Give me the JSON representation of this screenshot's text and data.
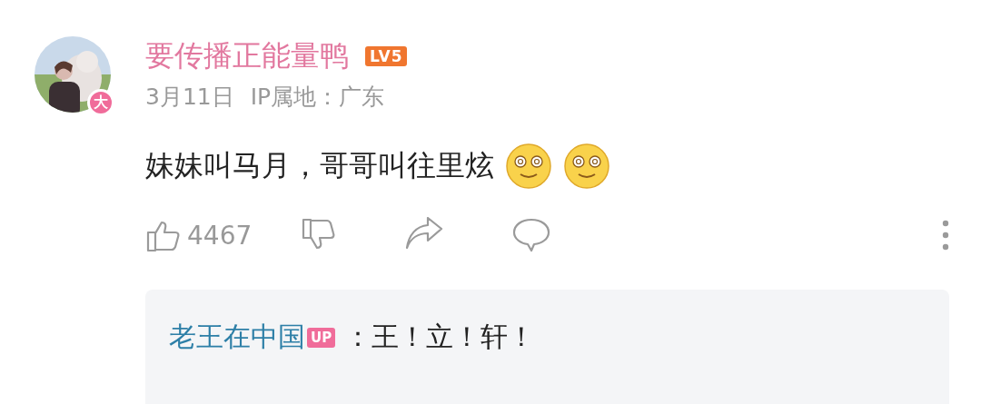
{
  "comment": {
    "avatar": {
      "kind": "picture",
      "badge": "大"
    },
    "username": "要传播正能量鸭",
    "level_badge": "LV5",
    "meta": {
      "date": "3月11日",
      "ip": "IP属地：广东"
    },
    "text": "妹妹叫马月，哥哥叫往里炫",
    "emojis": [
      {
        "kind": "dizzy-smile"
      },
      {
        "kind": "dizzy-smile"
      }
    ],
    "actions": {
      "likes": "4467"
    },
    "reply": {
      "author": "老王在中国",
      "author_badge": "UP",
      "text": "：王！立！轩！"
    }
  }
}
